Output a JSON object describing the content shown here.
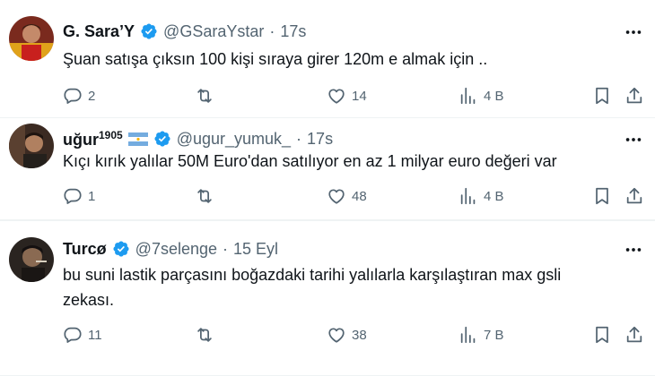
{
  "tweets": [
    {
      "name": "G. Sara’Y",
      "name_sup": "",
      "handle": "@GSaraYstar",
      "time": "17s",
      "text": "Şuan satışa çıksın 100 kişi sıraya girer 120m e almak için ..",
      "replies": "2",
      "retweets": "",
      "likes": "14",
      "views": "4 B"
    },
    {
      "name": "uğur",
      "name_sup": "1905",
      "handle": "@ugur_yumuk_",
      "time": "17s",
      "text": "Kıçı kırık yalılar 50M Euro'dan satılıyor en az 1 milyar euro değeri var",
      "replies": "1",
      "retweets": "",
      "likes": "48",
      "views": "4 B"
    },
    {
      "name": "Turcø",
      "name_sup": "",
      "handle": "@7selenge",
      "time": "15 Eyl",
      "text_line1": "bu suni lastik parçasını boğazdaki tarihi yalılarla karşılaştıran max gsli",
      "text_line2": "zekası.",
      "replies": "11",
      "retweets": "",
      "likes": "38",
      "views": "7 B"
    }
  ],
  "separator": "·",
  "colors": {
    "verified": "#1d9bf0",
    "muted": "#536471",
    "text": "#0f1419"
  }
}
